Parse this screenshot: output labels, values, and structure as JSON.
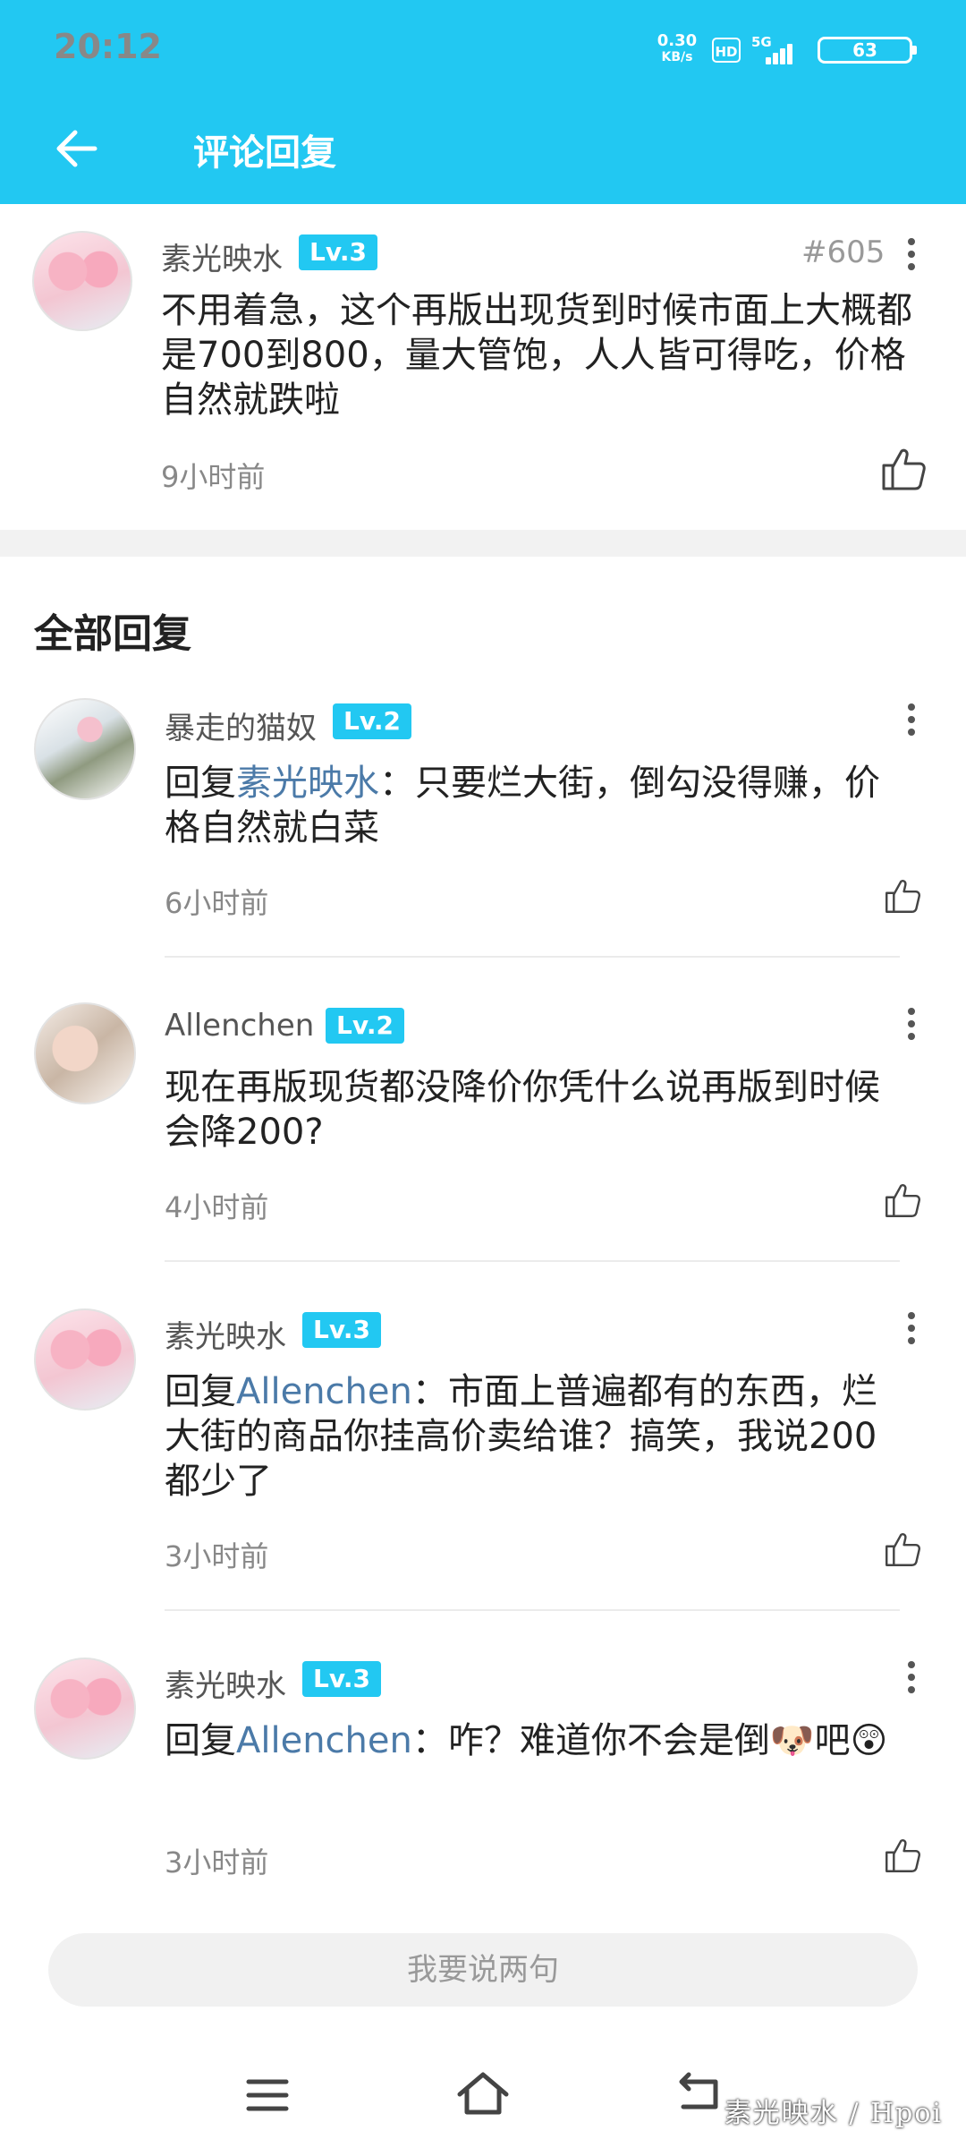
{
  "status_bar": {
    "time": "20:12",
    "net_speed": "0.30",
    "net_unit": "KB/s",
    "hd": "HD",
    "network": "5G",
    "battery": "63"
  },
  "app_bar": {
    "title": "评论回复"
  },
  "main_comment": {
    "username": "素光映水",
    "level": "Lv.3",
    "floor": "#605",
    "content": "不用着急，这个再版出现货到时候市面上大概都是700到800，量大管饱，人人皆可得吃，价格自然就跌啦",
    "time": "9小时前"
  },
  "section_title": "全部回复",
  "replies": [
    {
      "username": "暴走的猫奴",
      "level": "Lv.2",
      "prefix": "回复",
      "mention": "素光映水",
      "text": "：只要烂大街，倒勾没得赚，价格自然就白菜",
      "time": "6小时前"
    },
    {
      "username": "Allenchen",
      "level": "Lv.2",
      "prefix": "",
      "mention": "",
      "text": "现在再版现货都没降价你凭什么说再版到时候会降200?",
      "time": "4小时前"
    },
    {
      "username": "素光映水",
      "level": "Lv.3",
      "prefix": "回复",
      "mention": "Allenchen",
      "text": "：市面上普遍都有的东西，烂大街的商品你挂高价卖给谁？搞笑，我说200都少了",
      "time": "3小时前"
    },
    {
      "username": "素光映水",
      "level": "Lv.3",
      "prefix": "回复",
      "mention": "Allenchen",
      "text": "：咋？难道你不会是倒🐶吧😲",
      "time": "3小时前"
    }
  ],
  "input": {
    "placeholder": "我要说两句"
  },
  "watermark": "素光映水 / Hpoi",
  "colors": {
    "accent": "#22c8f2",
    "mention": "#4b7aa8"
  }
}
